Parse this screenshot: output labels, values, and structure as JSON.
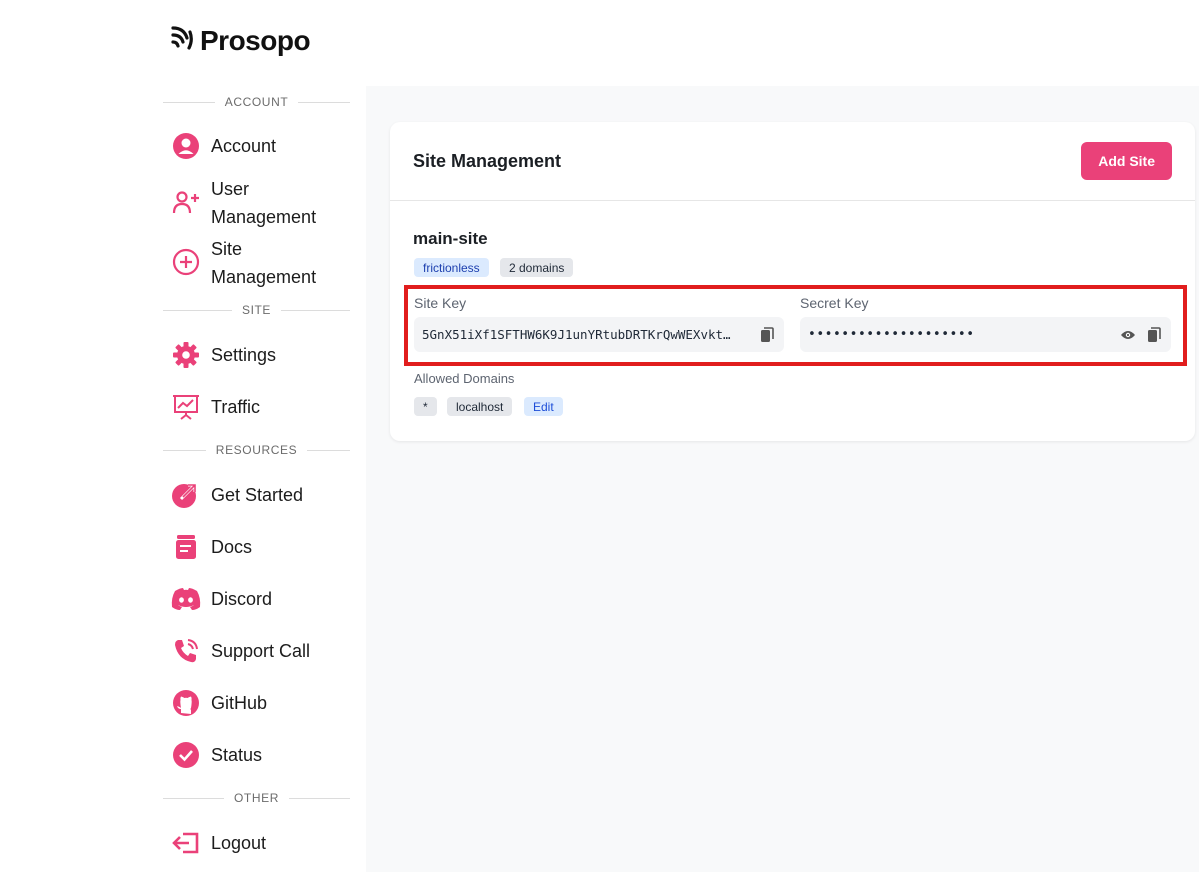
{
  "brand": {
    "name": "Prosopo"
  },
  "sidebar": {
    "sections": {
      "account": "ACCOUNT",
      "site": "SITE",
      "resources": "RESOURCES",
      "other": "OTHER"
    },
    "items": {
      "account": {
        "label": "Account",
        "icon": "user-circle-icon"
      },
      "user_mgmt_1": {
        "label": "User",
        "icon": "user-plus-icon"
      },
      "user_mgmt_2": {
        "label": "Management"
      },
      "site_mgmt_1": {
        "label": "Site",
        "icon": "plus-circle-icon"
      },
      "site_mgmt_2": {
        "label": "Management"
      },
      "settings": {
        "label": "Settings",
        "icon": "gear-icon"
      },
      "traffic": {
        "label": "Traffic",
        "icon": "chart-icon"
      },
      "get_started": {
        "label": "Get Started",
        "icon": "rocket-icon"
      },
      "docs": {
        "label": "Docs",
        "icon": "docs-icon"
      },
      "discord": {
        "label": "Discord",
        "icon": "discord-icon"
      },
      "support": {
        "label": "Support Call",
        "icon": "phone-icon"
      },
      "github": {
        "label": "GitHub",
        "icon": "github-icon"
      },
      "status": {
        "label": "Status",
        "icon": "check-circle-icon"
      },
      "logout": {
        "label": "Logout",
        "icon": "logout-icon"
      }
    }
  },
  "main": {
    "title": "Site Management",
    "add_button": "Add Site",
    "site": {
      "name": "main-site",
      "badges": [
        "frictionless",
        "2 domains"
      ],
      "site_key_label": "Site Key",
      "site_key_value": "5GnX51iXf1SFTHW6K9J1unYRtubDRTKrQwWEXvkt…",
      "secret_key_label": "Secret Key",
      "secret_key_value": "••••••••••••••••••••",
      "allowed_domains_label": "Allowed Domains",
      "domains": [
        "*",
        "localhost"
      ],
      "edit_label": "Edit"
    }
  },
  "colors": {
    "accent": "#ea4179",
    "highlight": "#e11d1d"
  }
}
